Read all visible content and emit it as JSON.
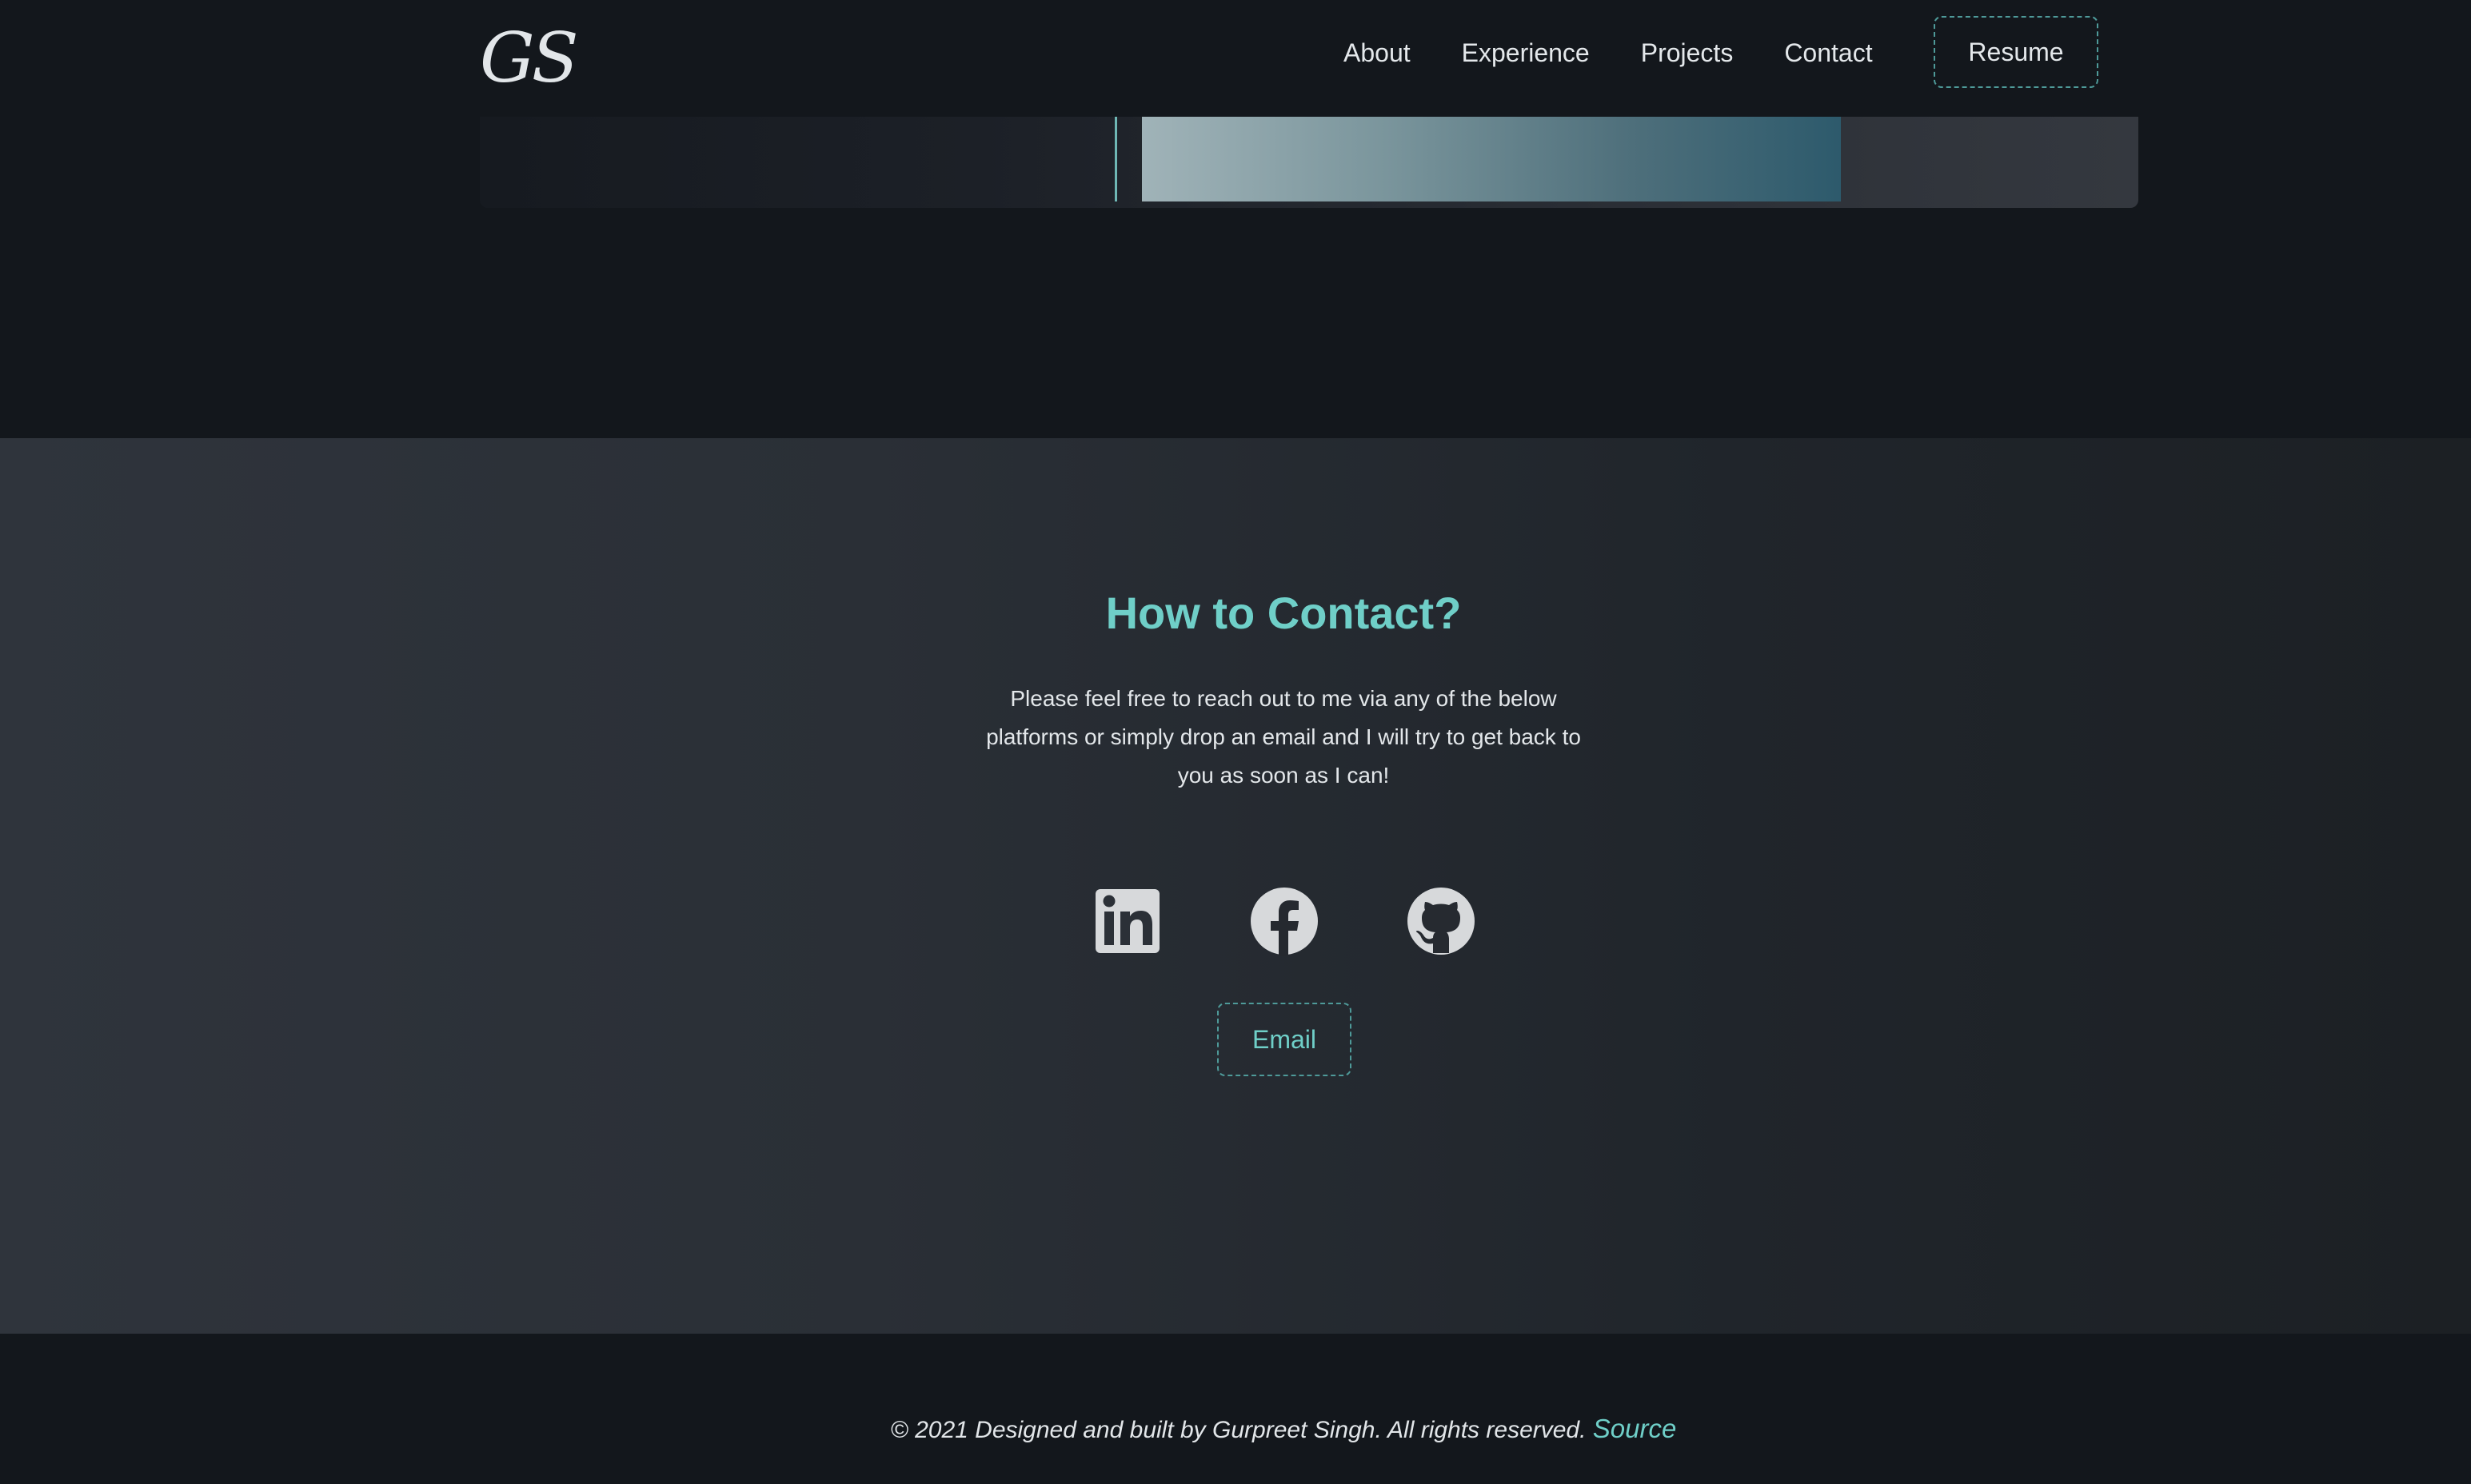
{
  "nav": {
    "logo": "GS",
    "links": [
      "About",
      "Experience",
      "Projects",
      "Contact"
    ],
    "resume_label": "Resume"
  },
  "contact": {
    "title": "How to Contact?",
    "description": "Please feel free to reach out to me via any of the below platforms or simply drop an email and I will try to get back to you as soon as I can!",
    "socials": [
      {
        "name": "linkedin",
        "icon": "linkedin-icon"
      },
      {
        "name": "facebook",
        "icon": "facebook-icon"
      },
      {
        "name": "github",
        "icon": "github-icon"
      }
    ],
    "email_label": "Email"
  },
  "footer": {
    "text": "© 2021 Designed and built by Gurpreet Singh. All rights reserved.",
    "source_label": "Source"
  },
  "colors": {
    "accent": "#6fcfc8",
    "background": "#13171c",
    "section_bg": "#2a2f36",
    "icon": "#d7d9db"
  }
}
